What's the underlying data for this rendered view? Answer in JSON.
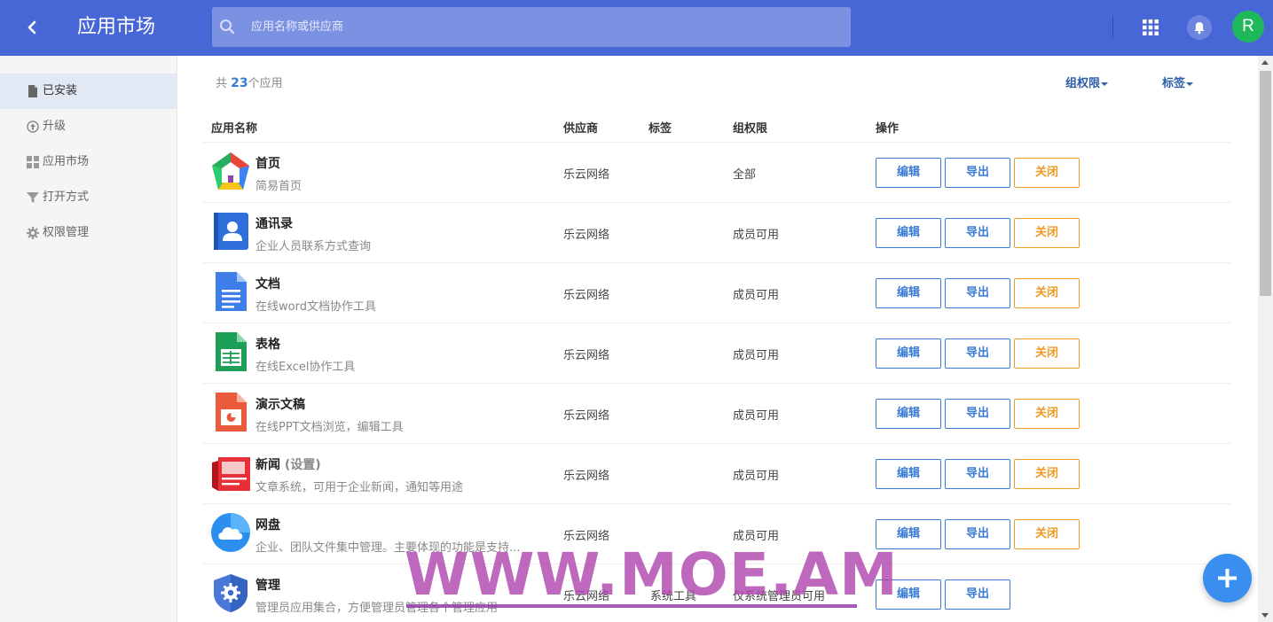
{
  "header": {
    "title": "应用市场",
    "search_placeholder": "应用名称或供应商",
    "avatar_letter": "R",
    "accent_color": "#4867d6"
  },
  "sidebar": {
    "items": [
      {
        "label": "已安装",
        "icon": "file-icon",
        "active": true
      },
      {
        "label": "升级",
        "icon": "upgrade-icon"
      },
      {
        "label": "应用市场",
        "icon": "grid-icon"
      },
      {
        "label": "打开方式",
        "icon": "filter-icon"
      },
      {
        "label": "权限管理",
        "icon": "gear-icon"
      }
    ]
  },
  "summary": {
    "prefix": "共",
    "count": "23",
    "suffix": "个应用"
  },
  "filters": {
    "permission": "组权限",
    "tag": "标签"
  },
  "table": {
    "headers": {
      "name": "应用名称",
      "vendor": "供应商",
      "tag": "标签",
      "permission": "组权限",
      "actions": "操作"
    },
    "buttons": {
      "edit": "编辑",
      "export": "导出",
      "close": "关闭"
    },
    "rows": [
      {
        "name": "首页",
        "name_extra": "",
        "desc": "简易首页",
        "vendor": "乐云网络",
        "tag": "",
        "permission": "全部",
        "icon": "home-app-icon",
        "closable": true
      },
      {
        "name": "通讯录",
        "name_extra": "",
        "desc": "企业人员联系方式查询",
        "vendor": "乐云网络",
        "tag": "",
        "permission": "成员可用",
        "icon": "contacts-app-icon",
        "closable": true
      },
      {
        "name": "文档",
        "name_extra": "",
        "desc": "在线word文档协作工具",
        "vendor": "乐云网络",
        "tag": "",
        "permission": "成员可用",
        "icon": "docs-app-icon",
        "closable": true
      },
      {
        "name": "表格",
        "name_extra": "",
        "desc": "在线Excel协作工具",
        "vendor": "乐云网络",
        "tag": "",
        "permission": "成员可用",
        "icon": "sheets-app-icon",
        "closable": true
      },
      {
        "name": "演示文稿",
        "name_extra": "",
        "desc": "在线PPT文档浏览，编辑工具",
        "vendor": "乐云网络",
        "tag": "",
        "permission": "成员可用",
        "icon": "slides-app-icon",
        "closable": true
      },
      {
        "name": "新闻",
        "name_extra": "(设置)",
        "desc": "文章系统，可用于企业新闻，通知等用途",
        "vendor": "乐云网络",
        "tag": "",
        "permission": "成员可用",
        "icon": "news-app-icon",
        "closable": true
      },
      {
        "name": "网盘",
        "name_extra": "",
        "desc": "企业、团队文件集中管理。主要体现的功能是支持...",
        "vendor": "乐云网络",
        "tag": "",
        "permission": "成员可用",
        "icon": "cloud-drive-app-icon",
        "closable": true
      },
      {
        "name": "管理",
        "name_extra": "",
        "desc": "管理员应用集合，方便管理员管理各个管理应用",
        "vendor": "乐云网络",
        "tag": "系统工具",
        "permission": "仅系统管理员可用",
        "icon": "admin-app-icon",
        "closable": false
      }
    ]
  },
  "watermark": "WWW.MOE.AM"
}
